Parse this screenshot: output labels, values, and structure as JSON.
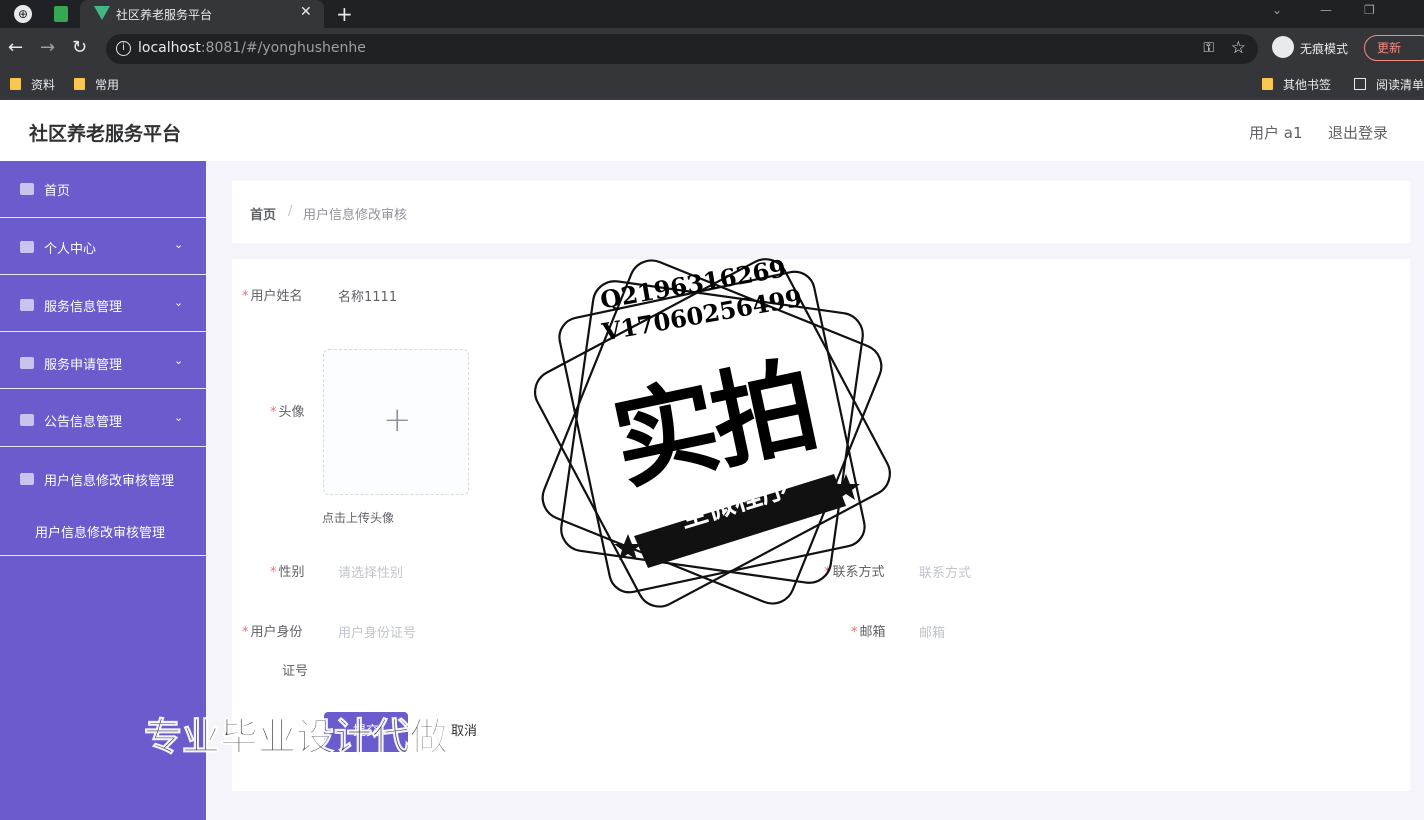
{
  "browser": {
    "tab_title": "社区养老服务平台",
    "url_host": "localhost",
    "url_rest": ":8081/#/yonghushenhe",
    "incognito_label": "无痕模式",
    "update_label": "更新",
    "bookmarks": [
      {
        "label": "资料"
      },
      {
        "label": "常用"
      }
    ],
    "other_bookmarks": "其他书签",
    "reading_list": "阅读清单"
  },
  "header": {
    "title": "社区养老服务平台",
    "user": "用户 a1",
    "logout": "退出登录"
  },
  "sidebar": {
    "items": [
      {
        "label": "首页",
        "icon": "home-icon"
      },
      {
        "label": "个人中心",
        "icon": "user-icon"
      },
      {
        "label": "服务信息管理",
        "icon": "list-icon"
      },
      {
        "label": "服务申请管理",
        "icon": "clipboard-icon"
      },
      {
        "label": "公告信息管理",
        "icon": "list-icon"
      },
      {
        "label": "用户信息修改审核管理",
        "icon": "user-icon"
      }
    ],
    "submenu": {
      "label": "用户信息修改审核管理"
    }
  },
  "breadcrumb": {
    "home": "首页",
    "separator": "/",
    "current": "用户信息修改审核"
  },
  "form": {
    "username_label": "用户姓名",
    "username_value": "名称1111",
    "avatar_label": "头像",
    "upload_tip": "点击上传头像",
    "gender_label": "性别",
    "gender_placeholder": "请选择性别",
    "contact_label": "联系方式",
    "contact_placeholder": "联系方式",
    "id_label_line1": "用户身份",
    "id_label_line2": "证号",
    "id_placeholder": "用户身份证号",
    "email_label": "邮箱",
    "email_placeholder": "邮箱",
    "submit_label": "提交",
    "cancel_label": "取消"
  },
  "watermark": {
    "qq": "Q2196316269",
    "wechat": "V17060256499",
    "big_text": "实拍",
    "ribbon_text": "全微程序",
    "bottom_text": "专业毕业设计代做"
  },
  "colors": {
    "accent": "#6a5ccc",
    "required": "#f56c6c"
  }
}
